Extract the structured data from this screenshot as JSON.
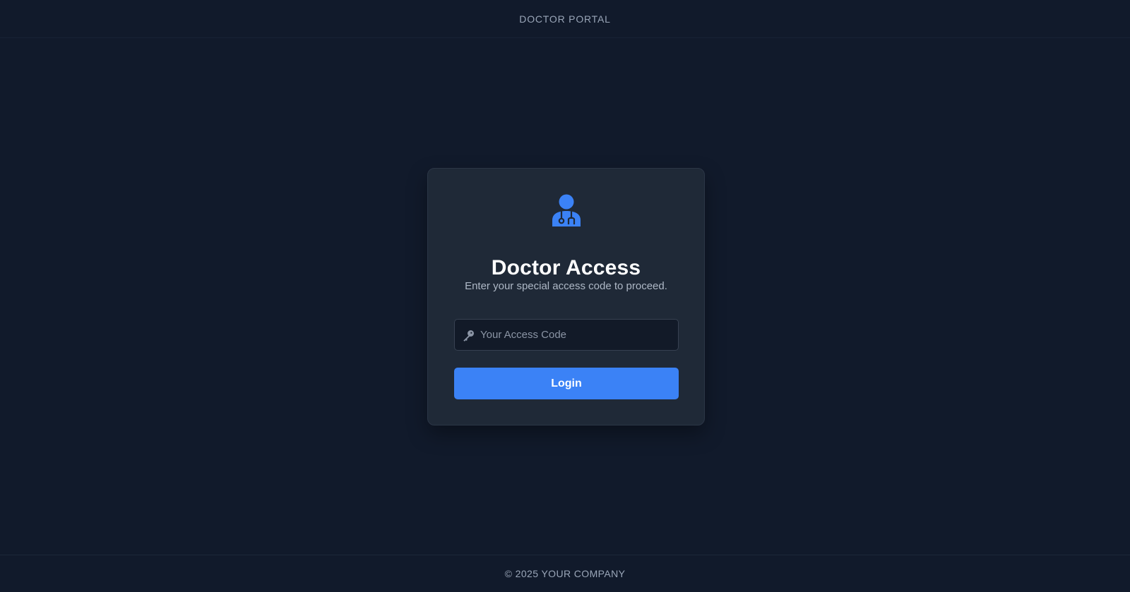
{
  "header": {
    "title": "DOCTOR PORTAL"
  },
  "login_card": {
    "icon": "doctor-icon",
    "title": "Doctor Access",
    "subtitle": "Enter your special access code to proceed.",
    "access_code_field": {
      "icon": "key-icon",
      "placeholder": "Your Access Code",
      "value": ""
    },
    "login_button_label": "Login"
  },
  "footer": {
    "text": "© 2025 YOUR COMPANY"
  },
  "colors": {
    "background": "#111a2b",
    "card": "#1f2937",
    "accent": "#3b82f6"
  }
}
